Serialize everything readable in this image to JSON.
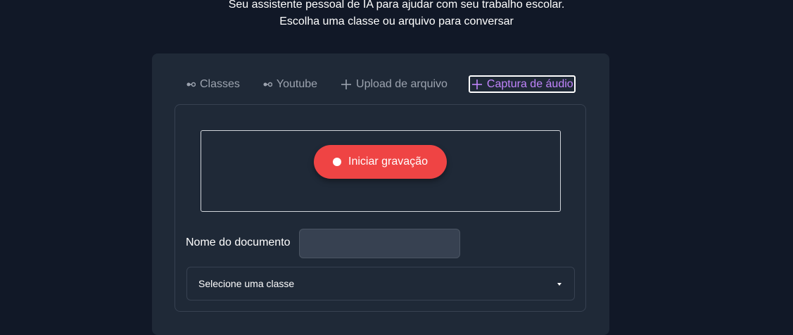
{
  "intro": {
    "line1": "Seu assistente pessoal de IA para ajudar com seu trabalho escolar.",
    "line2": "Escolha uma classe ou arquivo para conversar"
  },
  "tabs": [
    {
      "label": "Classes",
      "icon": "link-icon"
    },
    {
      "label": "Youtube",
      "icon": "link-icon"
    },
    {
      "label": "Upload de arquivo",
      "icon": "plus-icon"
    },
    {
      "label": "Captura de áudio",
      "icon": "plus-icon",
      "active": true
    }
  ],
  "recorder": {
    "button_label": "Iniciar gravação",
    "button_color": "#ef4444"
  },
  "document": {
    "name_label": "Nome do documento",
    "name_value": ""
  },
  "class_select": {
    "selected": "Selecione uma classe"
  },
  "colors": {
    "background": "#111827",
    "card": "#1f2937",
    "accent": "#c084fc"
  }
}
